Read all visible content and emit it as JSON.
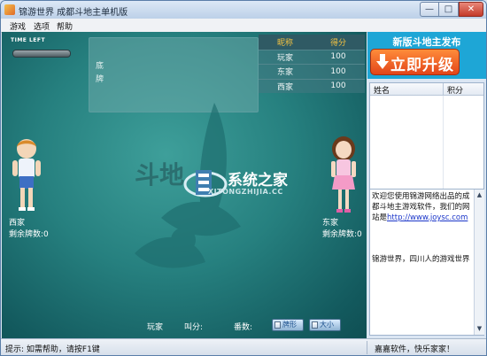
{
  "window": {
    "title": "锦游世界 成都斗地主单机版",
    "buttons": {
      "minimize": "—",
      "maximize": "□",
      "close": "✕"
    }
  },
  "menu": {
    "items": [
      "游戏",
      "选项",
      "帮助"
    ]
  },
  "game": {
    "time_left_label": "TIME LEFT",
    "card_panel": {
      "label1": "底",
      "label2": "牌"
    },
    "score_table": {
      "headers": [
        "昵称",
        "得分"
      ],
      "rows": [
        {
          "name": "玩家",
          "score": "100"
        },
        {
          "name": "东家",
          "score": "100"
        },
        {
          "name": "西家",
          "score": "100"
        }
      ]
    },
    "watermark": {
      "title": "系统之家",
      "subtitle": "XITONGZHIJIA.CC",
      "game_mark": "斗地"
    },
    "players": {
      "left": {
        "name": "西家",
        "remaining": "剩余牌数:0"
      },
      "right": {
        "name": "东家",
        "remaining": "剩余牌数:0"
      }
    },
    "bottom_bar": {
      "player_label": "玩家",
      "bid_label": "叫分:",
      "multiplier_label": "番数:",
      "sort_button": "牌形",
      "size_button": "大小"
    }
  },
  "sidebar": {
    "promo_title": "新版斗地主发布",
    "promo_button": "立即升级",
    "list_headers": {
      "name": "姓名",
      "score": "积分"
    },
    "scroll_left": "◀",
    "scroll_right": "▶",
    "scroll_up": "▲",
    "scroll_down": "▼",
    "message_prefix": "欢迎您使用锦游网络出品的成都斗地主游戏软件，我们的网站是",
    "message_url": "http://www.joysc.com",
    "message_tail": "锦游世界，四川人的游戏世界"
  },
  "status": {
    "hint": "提示:  如需帮助，请按F1键",
    "company": "嘉嘉软件，快乐家家！"
  },
  "colors": {
    "accent": "#1ea6d6",
    "table_bg": "#26807f",
    "promo_button": "#e2451a"
  }
}
